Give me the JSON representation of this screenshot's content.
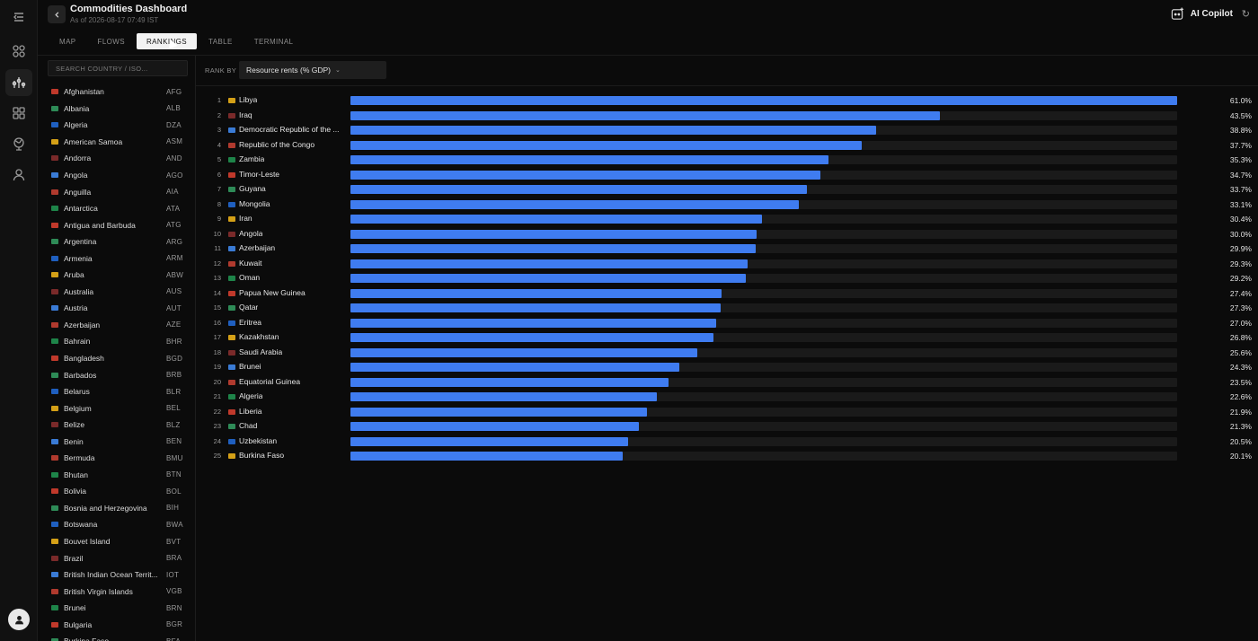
{
  "app": {
    "title": "Commodities Dashboard",
    "subtitle": "As of 2026-08-17 07:49 IST",
    "copilot_label": "AI Copilot",
    "accent_color": "#3f7cf0"
  },
  "tabs": [
    {
      "label": "MAP",
      "active": false
    },
    {
      "label": "FLOWS",
      "active": false
    },
    {
      "label": "RANKINGS",
      "active": true
    },
    {
      "label": "TABLE",
      "active": false
    },
    {
      "label": "TERMINAL",
      "active": false
    }
  ],
  "search": {
    "placeholder": "SEARCH COUNTRY / ISO..."
  },
  "countries": [
    {
      "name": "Afghanistan",
      "iso": "AFG"
    },
    {
      "name": "Albania",
      "iso": "ALB"
    },
    {
      "name": "Algeria",
      "iso": "DZA"
    },
    {
      "name": "American Samoa",
      "iso": "ASM"
    },
    {
      "name": "Andorra",
      "iso": "AND"
    },
    {
      "name": "Angola",
      "iso": "AGO"
    },
    {
      "name": "Anguilla",
      "iso": "AIA"
    },
    {
      "name": "Antarctica",
      "iso": "ATA"
    },
    {
      "name": "Antigua and Barbuda",
      "iso": "ATG"
    },
    {
      "name": "Argentina",
      "iso": "ARG"
    },
    {
      "name": "Armenia",
      "iso": "ARM"
    },
    {
      "name": "Aruba",
      "iso": "ABW"
    },
    {
      "name": "Australia",
      "iso": "AUS"
    },
    {
      "name": "Austria",
      "iso": "AUT"
    },
    {
      "name": "Azerbaijan",
      "iso": "AZE"
    },
    {
      "name": "Bahrain",
      "iso": "BHR"
    },
    {
      "name": "Bangladesh",
      "iso": "BGD"
    },
    {
      "name": "Barbados",
      "iso": "BRB"
    },
    {
      "name": "Belarus",
      "iso": "BLR"
    },
    {
      "name": "Belgium",
      "iso": "BEL"
    },
    {
      "name": "Belize",
      "iso": "BLZ"
    },
    {
      "name": "Benin",
      "iso": "BEN"
    },
    {
      "name": "Bermuda",
      "iso": "BMU"
    },
    {
      "name": "Bhutan",
      "iso": "BTN"
    },
    {
      "name": "Bolivia",
      "iso": "BOL"
    },
    {
      "name": "Bosnia and Herzegovina",
      "iso": "BIH"
    },
    {
      "name": "Botswana",
      "iso": "BWA"
    },
    {
      "name": "Bouvet Island",
      "iso": "BVT"
    },
    {
      "name": "Brazil",
      "iso": "BRA"
    },
    {
      "name": "British Indian Ocean Territ...",
      "iso": "IOT"
    },
    {
      "name": "British Virgin Islands",
      "iso": "VGB"
    },
    {
      "name": "Brunei",
      "iso": "BRN"
    },
    {
      "name": "Bulgaria",
      "iso": "BGR"
    },
    {
      "name": "Burkina Faso",
      "iso": "BFA"
    }
  ],
  "rank_by": {
    "label": "RANK BY",
    "selected": "Resource rents (% GDP)"
  },
  "rankings": [
    {
      "rank": "1",
      "country": "Libya",
      "value": 61.0,
      "display": "61.0%"
    },
    {
      "rank": "2",
      "country": "Iraq",
      "value": 43.5,
      "display": "43.5%"
    },
    {
      "rank": "3",
      "country": "Democratic Republic of the ...",
      "value": 38.8,
      "display": "38.8%"
    },
    {
      "rank": "4",
      "country": "Republic of the Congo",
      "value": 37.7,
      "display": "37.7%"
    },
    {
      "rank": "5",
      "country": "Zambia",
      "value": 35.3,
      "display": "35.3%"
    },
    {
      "rank": "6",
      "country": "Timor-Leste",
      "value": 34.7,
      "display": "34.7%"
    },
    {
      "rank": "7",
      "country": "Guyana",
      "value": 33.7,
      "display": "33.7%"
    },
    {
      "rank": "8",
      "country": "Mongolia",
      "value": 33.1,
      "display": "33.1%"
    },
    {
      "rank": "9",
      "country": "Iran",
      "value": 30.4,
      "display": "30.4%"
    },
    {
      "rank": "10",
      "country": "Angola",
      "value": 30.0,
      "display": "30.0%"
    },
    {
      "rank": "11",
      "country": "Azerbaijan",
      "value": 29.9,
      "display": "29.9%"
    },
    {
      "rank": "12",
      "country": "Kuwait",
      "value": 29.3,
      "display": "29.3%"
    },
    {
      "rank": "13",
      "country": "Oman",
      "value": 29.2,
      "display": "29.2%"
    },
    {
      "rank": "14",
      "country": "Papua New Guinea",
      "value": 27.4,
      "display": "27.4%"
    },
    {
      "rank": "15",
      "country": "Qatar",
      "value": 27.3,
      "display": "27.3%"
    },
    {
      "rank": "16",
      "country": "Eritrea",
      "value": 27.0,
      "display": "27.0%"
    },
    {
      "rank": "17",
      "country": "Kazakhstan",
      "value": 26.8,
      "display": "26.8%"
    },
    {
      "rank": "18",
      "country": "Saudi Arabia",
      "value": 25.6,
      "display": "25.6%"
    },
    {
      "rank": "19",
      "country": "Brunei",
      "value": 24.3,
      "display": "24.3%"
    },
    {
      "rank": "20",
      "country": "Equatorial Guinea",
      "value": 23.5,
      "display": "23.5%"
    },
    {
      "rank": "21",
      "country": "Algeria",
      "value": 22.6,
      "display": "22.6%"
    },
    {
      "rank": "22",
      "country": "Liberia",
      "value": 21.9,
      "display": "21.9%"
    },
    {
      "rank": "23",
      "country": "Chad",
      "value": 21.3,
      "display": "21.3%"
    },
    {
      "rank": "24",
      "country": "Uzbekistan",
      "value": 20.5,
      "display": "20.5%"
    },
    {
      "rank": "25",
      "country": "Burkina Faso",
      "value": 20.1,
      "display": "20.1%"
    }
  ],
  "chart_data": {
    "type": "bar",
    "categories": [
      "Libya",
      "Iraq",
      "Democratic Republic of the ...",
      "Republic of the Congo",
      "Zambia",
      "Timor-Leste",
      "Guyana",
      "Mongolia",
      "Iran",
      "Angola",
      "Azerbaijan",
      "Kuwait",
      "Oman",
      "Papua New Guinea",
      "Qatar",
      "Eritrea",
      "Kazakhstan",
      "Saudi Arabia",
      "Brunei",
      "Equatorial Guinea",
      "Algeria",
      "Liberia",
      "Chad",
      "Uzbekistan",
      "Burkina Faso"
    ],
    "values": [
      61.0,
      43.5,
      38.8,
      37.7,
      35.3,
      34.7,
      33.7,
      33.1,
      30.4,
      30.0,
      29.9,
      29.3,
      29.2,
      27.4,
      27.3,
      27.0,
      26.8,
      25.6,
      24.3,
      23.5,
      22.6,
      21.9,
      21.3,
      20.5,
      20.1
    ],
    "orientation": "horizontal",
    "grid": false
  }
}
